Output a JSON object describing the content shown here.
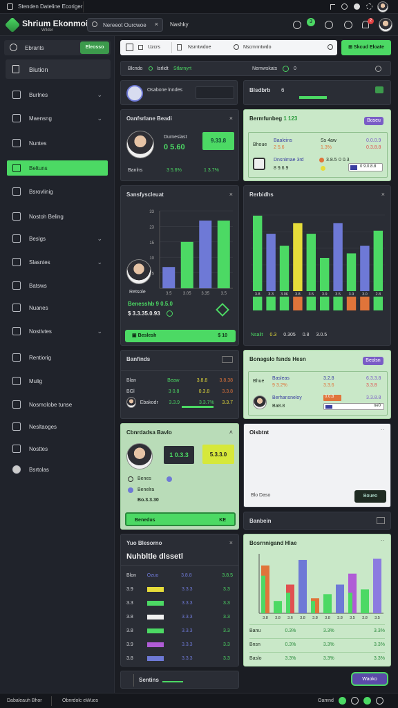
{
  "topbar": {
    "title": "Stenden Dateline Ecoriger",
    "icons": [
      "flag-icon",
      "sun-icon",
      "github-icon",
      "gear-icon"
    ]
  },
  "header": {
    "app_name": "Shrium Ekonmoia",
    "app_sub": "Wilder",
    "search_placeholder": "Nereeot Ourcwoe",
    "tab": "Nashky",
    "badge_count": "3",
    "notif_count": "2"
  },
  "sidebar": {
    "top_label": "Ebrants",
    "top_button": "Eleosso",
    "section": "Biution",
    "items": [
      {
        "label": "Burlnes",
        "chev": true,
        "icon": "trash-icon"
      },
      {
        "label": "Maensng",
        "chev": true,
        "icon": "film-icon"
      },
      {
        "label": "Nuntes",
        "chev": false,
        "icon": "folder-icon"
      },
      {
        "label": "Beltuns",
        "chev": false,
        "icon": "tag-icon",
        "active": true
      },
      {
        "label": "Bsrovlinig",
        "chev": false,
        "icon": "calendar-icon"
      },
      {
        "label": "Nostoh Beling",
        "chev": false,
        "icon": "mail-icon"
      },
      {
        "label": "Beslgs",
        "chev": true,
        "icon": "pin-icon"
      },
      {
        "label": "Slasntes",
        "chev": true,
        "icon": "link-icon"
      },
      {
        "label": "Batsws",
        "chev": false,
        "icon": "image-icon"
      },
      {
        "label": "Nuanes",
        "chev": false,
        "icon": "text-icon"
      },
      {
        "label": "Nostivtes",
        "chev": true,
        "icon": "doc-icon"
      },
      {
        "label": "Rentiorig",
        "chev": false,
        "icon": "search-icon"
      },
      {
        "label": "Mulig",
        "chev": false,
        "icon": "list-icon"
      },
      {
        "label": "Nosmolobe tunse",
        "chev": false,
        "icon": "user-icon"
      },
      {
        "label": "Nesltaoges",
        "chev": false,
        "icon": "globe-icon"
      },
      {
        "label": "Nosttes",
        "chev": false,
        "icon": "edit-icon"
      },
      {
        "label": "Bsrtolas",
        "chev": false,
        "icon": "circle-icon"
      }
    ]
  },
  "toolbar": {
    "filter1": "Uzcrs",
    "filter2": "Nsrntwdoe",
    "search": "Nscmnntwdo",
    "action": "Skcud Eloate"
  },
  "subbar": {
    "a": "Blcndo",
    "b": "Isrlidt",
    "c": "Stlarnyrt",
    "d": "Nemwskats",
    "e": "0"
  },
  "card_a": {
    "title": "Osabone lnndes"
  },
  "card_b": {
    "title": "Blsdbrb",
    "value": "6"
  },
  "card_c": {
    "title": "Oanfsrlane Beadi",
    "name": "Durneslast",
    "value": "0 5.60",
    "badge": "9.33.8",
    "foot1": "Banlns",
    "foot2": "3 5.6%",
    "foot3": "1 3.7%"
  },
  "card_d": {
    "title": "Bermfunbeg",
    "tag": "1 123",
    "pill": "Boseu",
    "r1a": "Bhoue",
    "r1b": "Baaleins",
    "r1c": "Ss 4aw",
    "r1d": "0.0.0.9",
    "r2a": "2 5.6",
    "r2b": "1.3%",
    "r2c": "0.3.8.8",
    "r3a": "Dnsnimae 3rd",
    "r3b": "3.8.5",
    "r3c": "0 0.3",
    "r3d": "0 9.0.8.8",
    "r4a": "8 9.6.9"
  },
  "card_e": {
    "title": "Sansfyscleuat",
    "label": "Retsole",
    "value1": "Benesshb 9 0.5.0",
    "value2": "$ 3.3.35.0.93",
    "button": "Beslesh",
    "button_end": "$ 10",
    "chart": {
      "type": "bar",
      "y_ticks": [
        "33",
        "23",
        "15",
        "10",
        "5"
      ],
      "categories": [
        "3.5",
        "3.05",
        "3.35",
        "3.5"
      ],
      "values": [
        11,
        24,
        35,
        35
      ],
      "colors": [
        "#6e79d6",
        "#4cd964",
        "#6e79d6",
        "#4cd964"
      ]
    }
  },
  "card_f": {
    "title": "Rerbidhs",
    "legend": [
      "Nsalit",
      "0.3",
      "0.305",
      "0.8",
      "3.0.5"
    ],
    "chart_data": {
      "type": "bar",
      "categories": [
        "3.8",
        "3.3",
        "3.06",
        "3.8",
        "3.5",
        "3.9",
        "3.5",
        "3.9",
        "3.0",
        "2.8"
      ],
      "series": [
        {
          "name": "Nsalit",
          "values": [
            50,
            38,
            30,
            45,
            38,
            22,
            45,
            25,
            30,
            40
          ]
        }
      ]
    }
  },
  "card_g": {
    "title": "Banfinds",
    "rows": [
      {
        "a": "Blan",
        "b": "Beaw",
        "c": "3.8.8",
        "d": "3.8.38"
      },
      {
        "a": "BGl",
        "b": "3 0.8",
        "c": "0.3.8",
        "d": "3.3.8"
      },
      {
        "a": "Ebakodr",
        "b": "3.3.9",
        "c": "3.3.7%",
        "d": "3.3.7"
      }
    ]
  },
  "card_h": {
    "title": "Bonagslo fsnds Hesn",
    "pill": "Beolsn",
    "r1": [
      "Bhue",
      "Basleas",
      "3.2.8",
      "6.3.3.8"
    ],
    "r2": [
      "9 3.2%",
      "3.3.6",
      "3.3.8"
    ],
    "r3": [
      "Berhansneloy",
      "0.0.8",
      "3.3.8.8"
    ],
    "r4": [
      "Ba8.8",
      "ne0"
    ]
  },
  "card_i": {
    "title": "Cbnrdadsa Bavlo",
    "value": "1 0.3.3",
    "badge": "5.3.3.0",
    "rows": [
      "Benes",
      "Benelra",
      "Bo.3.3.30"
    ],
    "button": "Benedus",
    "button_end": "KE"
  },
  "card_j": {
    "title": "Oisbtnt",
    "foot": "Blo Daso",
    "button": "Boueo"
  },
  "card_k": {
    "title": "Banbein"
  },
  "card_l": {
    "title": "Yuo Blesorno",
    "header": "Nuhbltle dlssetl",
    "rows": [
      {
        "a": "Blon",
        "b": "Ozuo",
        "c": "3.8.8",
        "d": "3.8.5"
      },
      {
        "a": "3.9",
        "b": "3.8",
        "c": "3.3.3",
        "d": "3.3"
      },
      {
        "a": "3.3",
        "b": "3.8",
        "c": "3.3.3",
        "d": "3.3"
      },
      {
        "a": "3.8",
        "b": "3.8",
        "c": "3.3.3",
        "d": "3.3"
      },
      {
        "a": "3.8",
        "b": "3.8",
        "c": "3.3.3",
        "d": "3.3"
      },
      {
        "a": "3.9",
        "b": "3.8",
        "c": "3.3.3",
        "d": "3.3"
      },
      {
        "a": "3.8",
        "b": "3.8",
        "c": "3.3.3",
        "d": "3.3"
      }
    ],
    "swatches": [
      "#e6dc3a",
      "#4cd964",
      "#f1f1f1",
      "#4cd964",
      "#b05cd6",
      "#6e79d6"
    ]
  },
  "card_m": {
    "title": "Bosrnnigand Hlae",
    "chart_data": {
      "type": "bar",
      "categories": [
        "3.8",
        "3.8",
        "3.6",
        "3.8",
        "3.8",
        "3.8",
        "3.8",
        "3.5",
        "3.8",
        "3.5"
      ],
      "series": [
        {
          "name": "A",
          "values": [
            70,
            18,
            42,
            78,
            22,
            28,
            42,
            58,
            35,
            80
          ]
        },
        {
          "name": "B",
          "values": [
            55,
            14,
            30,
            0,
            18,
            20,
            0,
            30,
            0,
            0
          ]
        }
      ],
      "colors": [
        "#e0743a",
        "#4cd964",
        "#e05050",
        "#6e79d6",
        "#e0743a",
        "#4cd964",
        "#6e79d6",
        "#b05cd6",
        "#4cd964",
        "#8b7be0"
      ]
    },
    "rows": [
      {
        "a": "Banu",
        "b": "0.3%",
        "c": "3.3%",
        "d": "3.3%"
      },
      {
        "a": "Bnsn",
        "b": "0.3%",
        "c": "3.3%",
        "d": "3.3%"
      },
      {
        "a": "Baslo",
        "b": "3.3%",
        "c": "3.3%",
        "d": "3.3%"
      }
    ]
  },
  "card_n": {
    "title": "Sentins",
    "pill": "Waoko"
  },
  "statusbar": {
    "left1": "Dabaleauh Bhor",
    "left2": "Obnrdolc eWuos",
    "right": "Oamnd"
  }
}
